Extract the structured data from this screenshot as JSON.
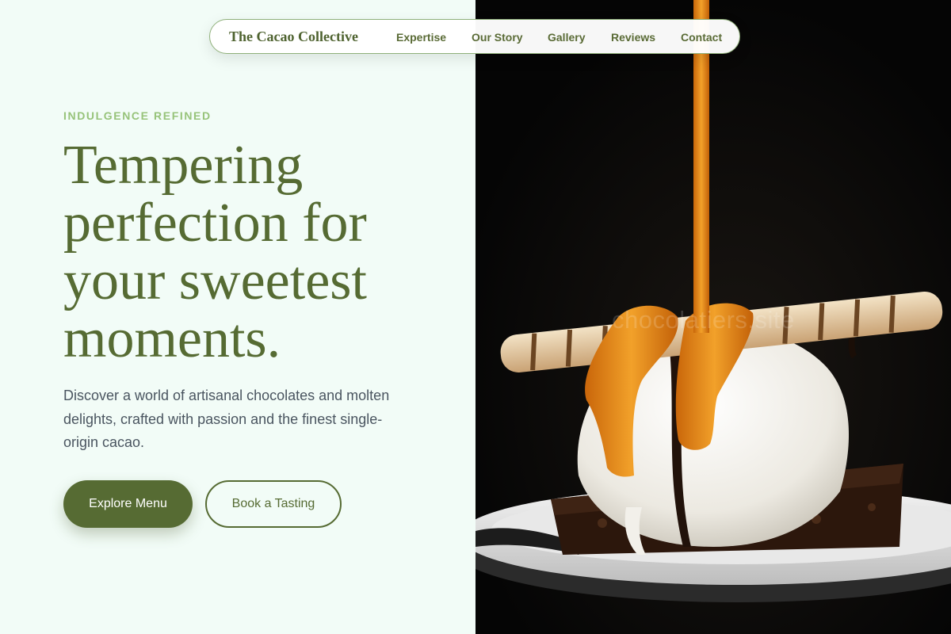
{
  "brand": {
    "name": "The Cacao Collective"
  },
  "nav": {
    "links": [
      {
        "label": "Expertise"
      },
      {
        "label": "Our Story"
      },
      {
        "label": "Gallery"
      },
      {
        "label": "Reviews"
      },
      {
        "label": "Contact"
      }
    ]
  },
  "hero": {
    "eyebrow": "INDULGENCE REFINED",
    "headline": "Tempering perfection for your sweetest moments.",
    "description": "Discover a world of artisanal chocolates and molten delights, crafted with passion and the finest single-origin cacao.",
    "primary_button": "Explore Menu",
    "secondary_button": "Book a Tasting",
    "image_watermark": "chocolatiers.site"
  },
  "colors": {
    "accent": "#566b33",
    "eyebrow": "#97c37a",
    "background": "#f2fcf7",
    "body_text": "#4a5560"
  }
}
